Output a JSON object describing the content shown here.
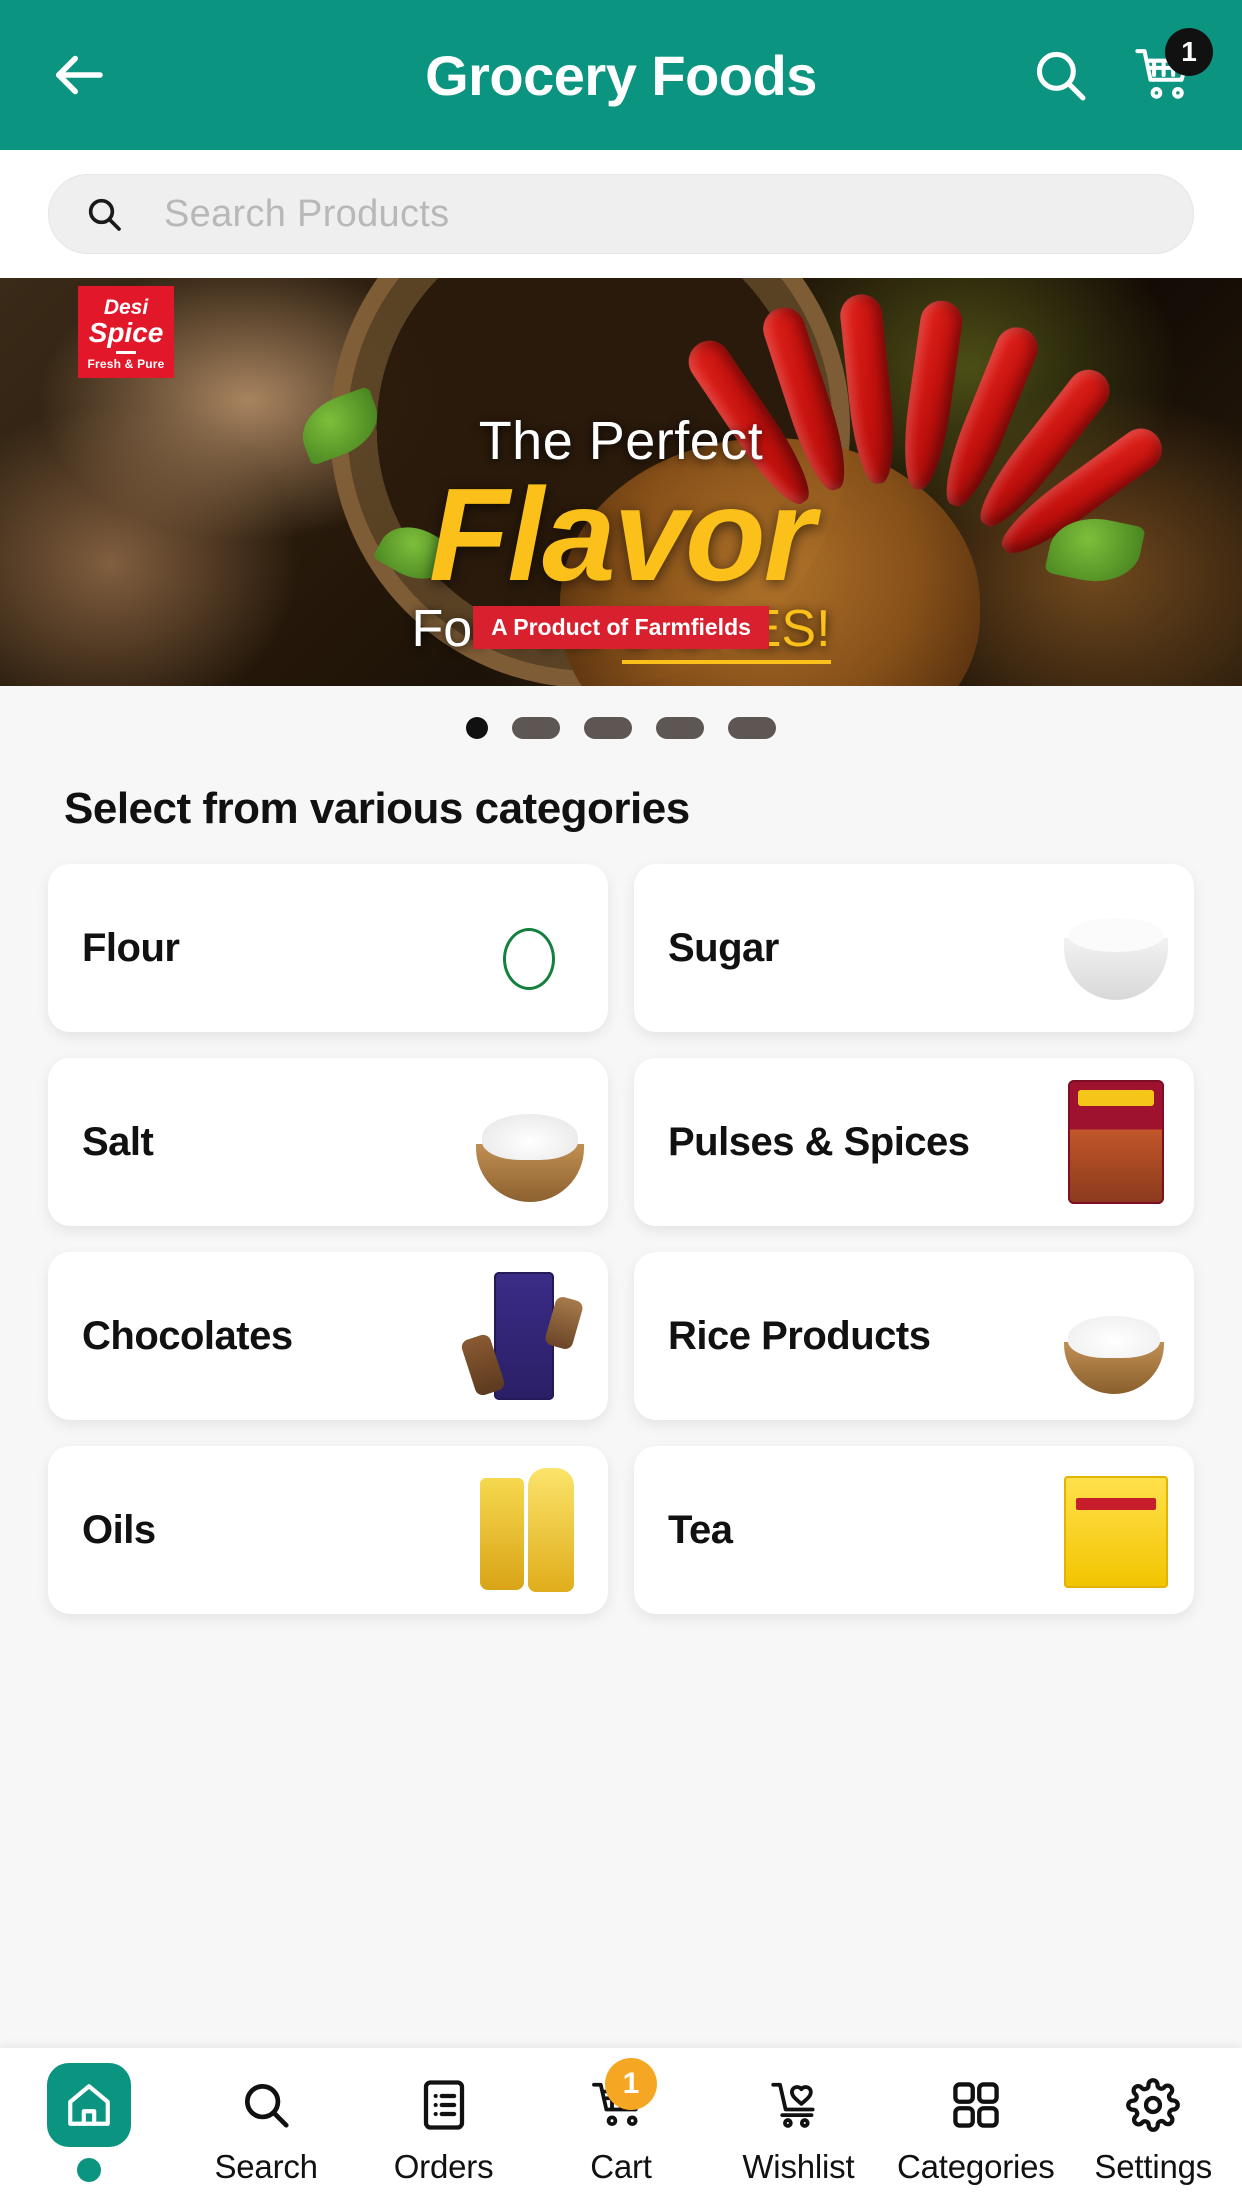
{
  "header": {
    "title": "Grocery Foods",
    "back_icon": "arrow-left-icon",
    "search_icon": "search-icon",
    "cart_icon": "cart-icon",
    "cart_badge": "1",
    "bg_color": "#0b9480"
  },
  "search": {
    "placeholder": "Search Products",
    "value": "",
    "icon": "search-icon"
  },
  "banner": {
    "logo_brand_line1": "Desi",
    "logo_brand_line2": "Spice",
    "logo_tagline": "Fresh & Pure",
    "headline_top": "The Perfect",
    "headline_main": "Flavor",
    "headline_sub_white": "For Your ",
    "headline_sub_accent": "DISHES!",
    "footer_tag": "A Product of Farmfields",
    "accent_color": "#fbc01a",
    "tag_color": "#d9202e"
  },
  "carousel": {
    "total": 5,
    "active_index": 0,
    "dots": [
      "active",
      "idle",
      "idle",
      "idle",
      "idle"
    ]
  },
  "categories": {
    "heading": "Select from various categories",
    "items": [
      {
        "label": "Flour",
        "thumb": "flour-bag-image"
      },
      {
        "label": "Sugar",
        "thumb": "sugar-bowl-image"
      },
      {
        "label": "Salt",
        "thumb": "salt-bowl-image"
      },
      {
        "label": "Pulses & Spices",
        "thumb": "spice-packet-image"
      },
      {
        "label": "Chocolates",
        "thumb": "chocolate-bar-image"
      },
      {
        "label": "Rice Products",
        "thumb": "rice-bowl-image"
      },
      {
        "label": "Oils",
        "thumb": "oil-bottles-image"
      },
      {
        "label": "Tea",
        "thumb": "tea-pack-image"
      }
    ]
  },
  "bottom_nav": {
    "active": "Home",
    "items": [
      {
        "label": "",
        "icon": "home-icon",
        "active": true,
        "badge": ""
      },
      {
        "label": "Search",
        "icon": "search-icon",
        "active": false,
        "badge": ""
      },
      {
        "label": "Orders",
        "icon": "orders-list-icon",
        "active": false,
        "badge": ""
      },
      {
        "label": "Cart",
        "icon": "cart-icon",
        "active": false,
        "badge": "1"
      },
      {
        "label": "Wishlist",
        "icon": "cart-heart-icon",
        "active": false,
        "badge": ""
      },
      {
        "label": "Categories",
        "icon": "grid-icon",
        "active": false,
        "badge": ""
      },
      {
        "label": "Settings",
        "icon": "gear-icon",
        "active": false,
        "badge": ""
      }
    ],
    "badge_color": "#f5a623",
    "active_color": "#0b9480"
  }
}
